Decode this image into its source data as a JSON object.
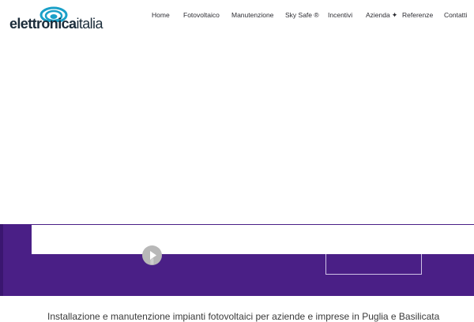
{
  "brand": {
    "logo_bold": "elettronica",
    "logo_light": "italia",
    "colors": {
      "logo_ring": "#1aa0c8",
      "logo_text": "#1b2c3a"
    }
  },
  "nav": {
    "items": [
      {
        "label": "Home"
      },
      {
        "label": "Fotovoltaico"
      },
      {
        "label": "Manutenzione"
      },
      {
        "label": "Sky Safe ®"
      },
      {
        "label": "Incentivi"
      },
      {
        "label": "Azienda",
        "submenu_icon": "plus-icon",
        "submenu_glyph": "✦"
      },
      {
        "label": "Referenze"
      },
      {
        "label": "Contatti"
      }
    ]
  },
  "hero": {
    "band_color": "#4a1f86",
    "video": {
      "play_icon": "play-icon",
      "pause_glyph": "||"
    }
  },
  "intro": {
    "text": "Installazione e manutenzione impianti fotovoltaici per aziende e imprese in Puglia e Basilicata"
  }
}
